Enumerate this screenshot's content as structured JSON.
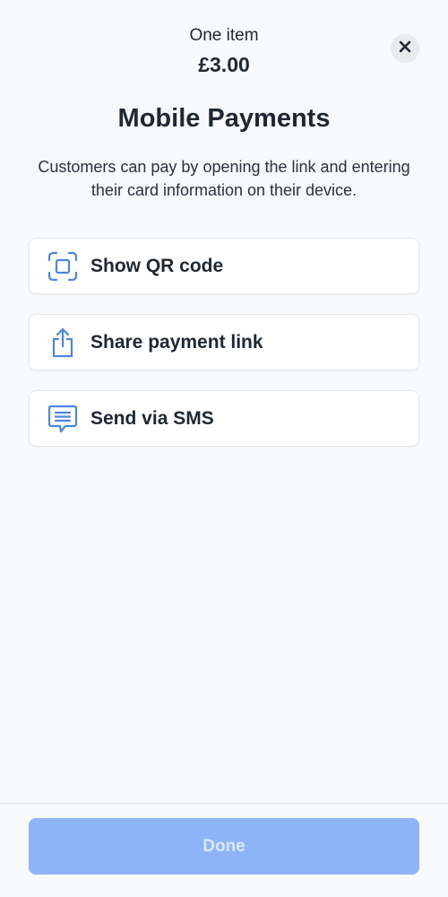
{
  "header": {
    "item_count": "One item",
    "total": "£3.00",
    "close_icon": "close-icon"
  },
  "main": {
    "title": "Mobile Payments",
    "description": "Customers can pay by opening the link and entering their card information on their device.",
    "options": [
      {
        "label": "Show QR code",
        "icon": "qr-code-icon"
      },
      {
        "label": "Share payment link",
        "icon": "share-icon"
      },
      {
        "label": "Send via SMS",
        "icon": "message-icon"
      }
    ]
  },
  "footer": {
    "done_label": "Done",
    "done_disabled": true
  },
  "colors": {
    "accent_icon": "#4a86e0",
    "done_button_bg": "#8db4f6",
    "done_button_text": "#dce8fb",
    "background": "#f7f9fa",
    "text": "#1f2733"
  }
}
